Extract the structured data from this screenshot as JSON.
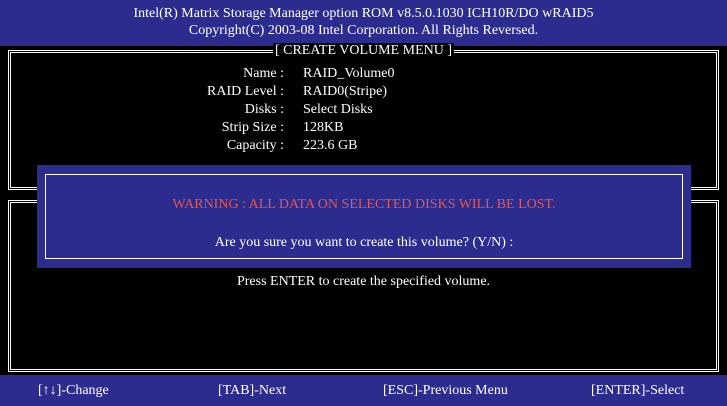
{
  "header": {
    "line1": "Intel(R) Matrix Storage Manager option ROM v8.5.0.1030 ICH10R/DO wRAID5",
    "line2": "Copyright(C) 2003-08 Intel Corporation.  All Rights Reversed."
  },
  "menu": {
    "title": "[ CREATE VOLUME MENU ]",
    "fields": [
      {
        "label": "Name :",
        "value": "RAID_Volume0"
      },
      {
        "label": "RAID Level :",
        "value": "RAID0(Stripe)"
      },
      {
        "label": "Disks :",
        "value": "Select Disks"
      },
      {
        "label": "Strip Size :",
        "value": "128KB"
      },
      {
        "label": "Capacity :",
        "value": "223.6 GB"
      }
    ]
  },
  "help": {
    "text": "Press ENTER to create the specified volume."
  },
  "dialog": {
    "warning": "WARNING : ALL DATA ON SELECTED DISKS WILL BE LOST.",
    "confirm": "Are you sure you want to create this volume? (Y/N) :"
  },
  "footer": {
    "change": "[↑↓]-Change",
    "next": "[TAB]-Next",
    "previous": "[ESC]-Previous Menu",
    "select": "[ENTER]-Select"
  },
  "colors": {
    "bar_background": "#2c2c8e",
    "warning_text": "#e8564c",
    "screen_background": "#000000",
    "text": "#ffffff"
  }
}
